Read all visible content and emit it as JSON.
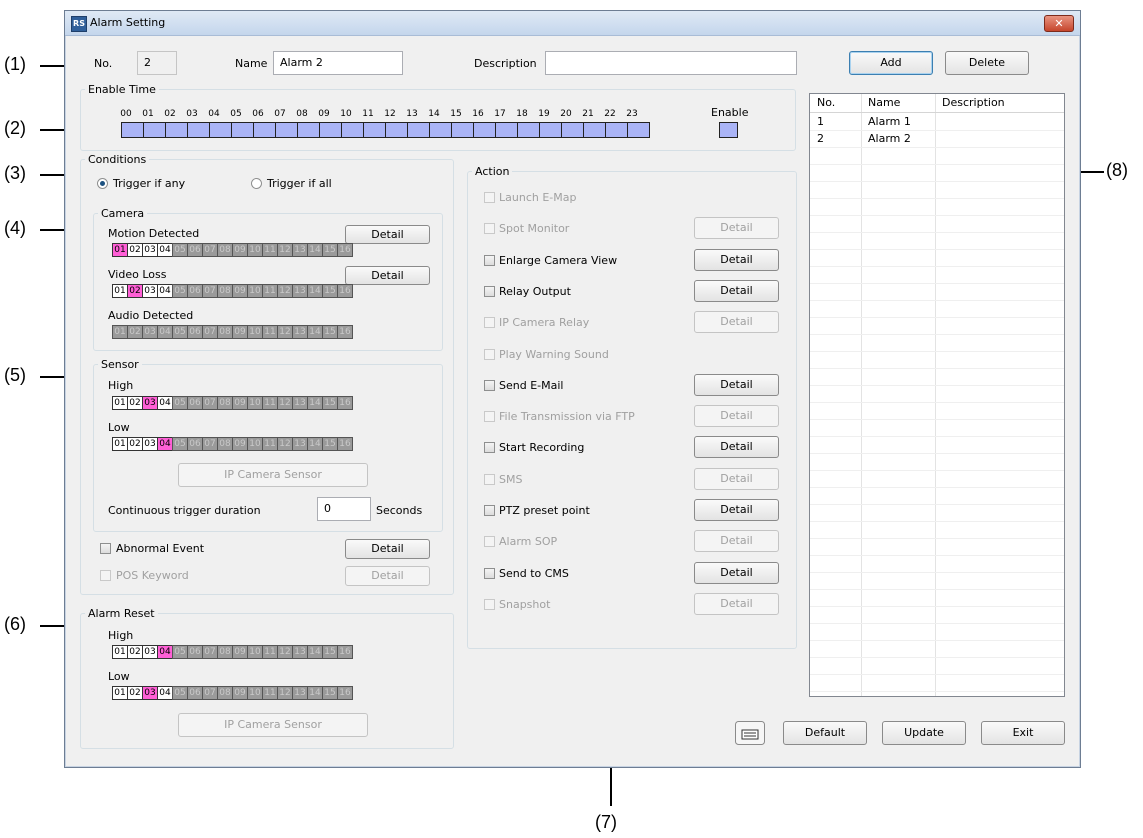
{
  "window": {
    "title": "Alarm Setting",
    "close": "✕"
  },
  "callouts": [
    "(1)",
    "(2)",
    "(3)",
    "(4)",
    "(5)",
    "(6)",
    "(7)",
    "(8)"
  ],
  "header": {
    "no_label": "No.",
    "no_value": "2",
    "name_label": "Name",
    "name_value": "Alarm 2",
    "description_label": "Description",
    "description_value": ""
  },
  "buttons": {
    "add": "Add",
    "delete": "Delete",
    "default": "Default",
    "update": "Update",
    "exit": "Exit",
    "keyboard_icon": "keyboard-icon"
  },
  "enable_time": {
    "title": "Enable Time",
    "hours": [
      "00",
      "01",
      "02",
      "03",
      "04",
      "05",
      "06",
      "07",
      "08",
      "09",
      "10",
      "11",
      "12",
      "13",
      "14",
      "15",
      "16",
      "17",
      "18",
      "19",
      "20",
      "21",
      "22",
      "23"
    ],
    "enable_label": "Enable"
  },
  "conditions": {
    "title": "Conditions",
    "trigger_any": "Trigger if any",
    "trigger_all": "Trigger if all",
    "camera": {
      "title": "Camera",
      "motion_label": "Motion Detected",
      "video_loss_label": "Video Loss",
      "audio_label": "Audio Detected",
      "detail": "Detail"
    },
    "sensor": {
      "title": "Sensor",
      "high_label": "High",
      "low_label": "Low",
      "ip_camera_sensor": "IP Camera Sensor",
      "duration_label": "Continuous trigger duration",
      "duration_value": "0",
      "seconds_label": "Seconds"
    },
    "abnormal_event": "Abnormal Event",
    "pos_keyword": "POS Keyword",
    "detail": "Detail"
  },
  "channels": [
    "01",
    "02",
    "03",
    "04",
    "05",
    "06",
    "07",
    "08",
    "09",
    "10",
    "11",
    "12",
    "13",
    "14",
    "15",
    "16"
  ],
  "alarm_reset": {
    "title": "Alarm Reset",
    "high_label": "High",
    "low_label": "Low",
    "ip_camera_sensor": "IP Camera Sensor"
  },
  "action": {
    "title": "Action",
    "items": [
      {
        "label": "Launch E-Map",
        "enabled": false,
        "detail": ""
      },
      {
        "label": "Spot Monitor",
        "enabled": false,
        "detail": "Detail"
      },
      {
        "label": "Enlarge Camera View",
        "enabled": true,
        "detail": "Detail"
      },
      {
        "label": "Relay Output",
        "enabled": true,
        "detail": "Detail"
      },
      {
        "label": "IP Camera Relay",
        "enabled": false,
        "detail": "Detail"
      },
      {
        "label": "Play Warning Sound",
        "enabled": false,
        "detail": ""
      },
      {
        "label": "Send E-Mail",
        "enabled": true,
        "detail": "Detail"
      },
      {
        "label": "File Transmission via FTP",
        "enabled": false,
        "detail": "Detail"
      },
      {
        "label": "Start Recording",
        "enabled": true,
        "detail": "Detail"
      },
      {
        "label": "SMS",
        "enabled": false,
        "detail": "Detail"
      },
      {
        "label": "PTZ preset point",
        "enabled": true,
        "detail": "Detail"
      },
      {
        "label": "Alarm SOP",
        "enabled": false,
        "detail": "Detail"
      },
      {
        "label": "Send to CMS",
        "enabled": true,
        "detail": "Detail"
      },
      {
        "label": "Snapshot",
        "enabled": false,
        "detail": "Detail"
      }
    ]
  },
  "alarm_list": {
    "columns": [
      "No.",
      "Name",
      "Description"
    ],
    "rows": [
      {
        "no": "1",
        "name": "Alarm 1",
        "description": ""
      },
      {
        "no": "2",
        "name": "Alarm 2",
        "description": ""
      }
    ]
  }
}
